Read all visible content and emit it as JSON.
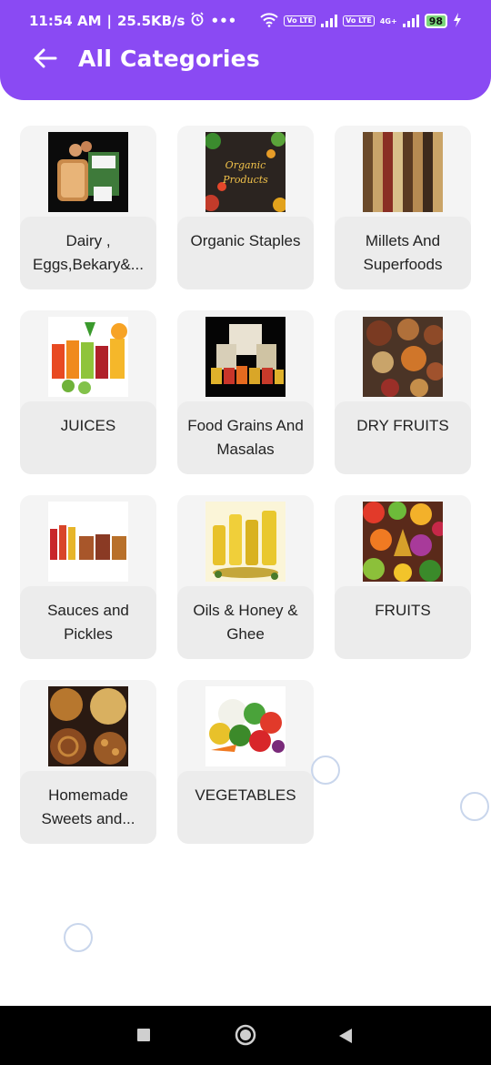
{
  "status": {
    "time": "11:54 AM",
    "speed": "25.5KB/s",
    "battery": "98",
    "lte1": "Vo LTE",
    "lte2": "Vo LTE",
    "net": "4G+"
  },
  "header": {
    "title": "All Categories",
    "back_icon": "arrow-left-icon"
  },
  "categories": [
    {
      "label": "Dairy , Eggs,Bekary&...",
      "icon": "bakery-products-image"
    },
    {
      "label": "Organic Staples",
      "icon": "organic-products-image",
      "image_text": "Organic Products"
    },
    {
      "label": "Millets And Superfoods",
      "icon": "millets-image"
    },
    {
      "label": "JUICES",
      "icon": "juices-image"
    },
    {
      "label": "Food Grains And Masalas",
      "icon": "grains-masalas-image"
    },
    {
      "label": "DRY FRUITS",
      "icon": "dry-fruits-image"
    },
    {
      "label": "Sauces and Pickles",
      "icon": "sauces-pickles-image"
    },
    {
      "label": "Oils & Honey & Ghee",
      "icon": "oils-honey-image"
    },
    {
      "label": "FRUITS",
      "icon": "fruits-image"
    },
    {
      "label": "Homemade Sweets and...",
      "icon": "sweets-image"
    },
    {
      "label": "VEGETABLES",
      "icon": "vegetables-image"
    }
  ],
  "colors": {
    "header": "#8a4af3",
    "card": "#f4f4f4",
    "card_label": "#ececec",
    "navbar": "#000000"
  }
}
